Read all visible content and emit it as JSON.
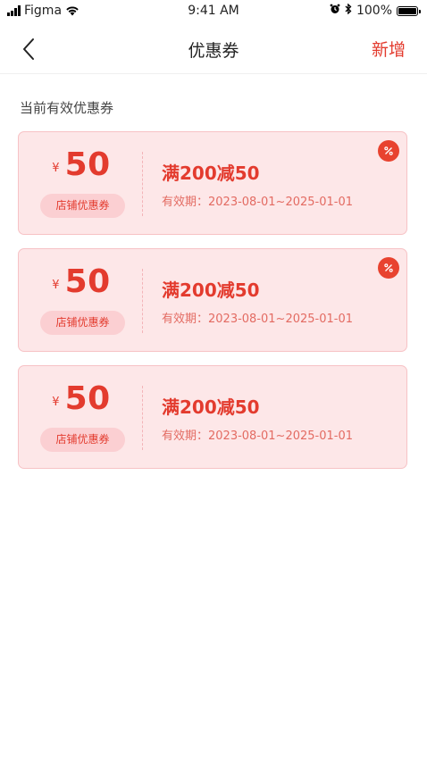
{
  "status_bar": {
    "carrier": "Figma",
    "time": "9:41 AM",
    "battery": "100%"
  },
  "nav": {
    "title": "优惠券",
    "add_label": "新增"
  },
  "section_title": "当前有效优惠券",
  "coupons": [
    {
      "currency": "¥",
      "amount": "50",
      "type": "店铺优惠券",
      "rule": "满200减50",
      "validity": "有效期：2023-08-01~2025-01-01",
      "badge": true
    },
    {
      "currency": "¥",
      "amount": "50",
      "type": "店铺优惠券",
      "rule": "满200减50",
      "validity": "有效期：2023-08-01~2025-01-01",
      "badge": true
    },
    {
      "currency": "¥",
      "amount": "50",
      "type": "店铺优惠券",
      "rule": "满200减50",
      "validity": "有效期：2023-08-01~2025-01-01",
      "badge": false
    }
  ],
  "colors": {
    "accent": "#e33b2e",
    "card_bg": "#fde7e8",
    "card_border": "#f7c2c5",
    "badge": "#e8432f"
  },
  "icons": {
    "back": "chevron-left-icon",
    "badge": "discount-percent-icon"
  }
}
